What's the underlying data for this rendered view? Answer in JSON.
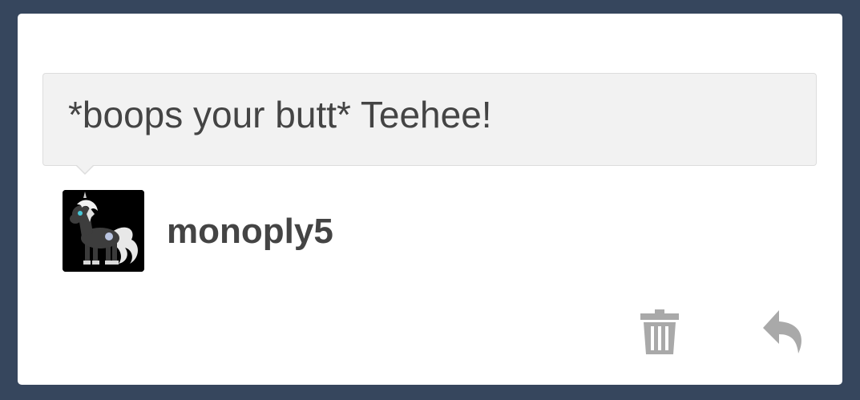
{
  "message": {
    "text": "*boops your butt* Teehee!"
  },
  "author": {
    "username": "monoply5"
  },
  "actions": {
    "delete_icon": "trash-icon",
    "reply_icon": "reply-icon"
  },
  "colors": {
    "background": "#36465d",
    "card": "#ffffff",
    "bubble": "#f2f2f2",
    "text": "#444444",
    "icon": "#a9a9a9"
  }
}
